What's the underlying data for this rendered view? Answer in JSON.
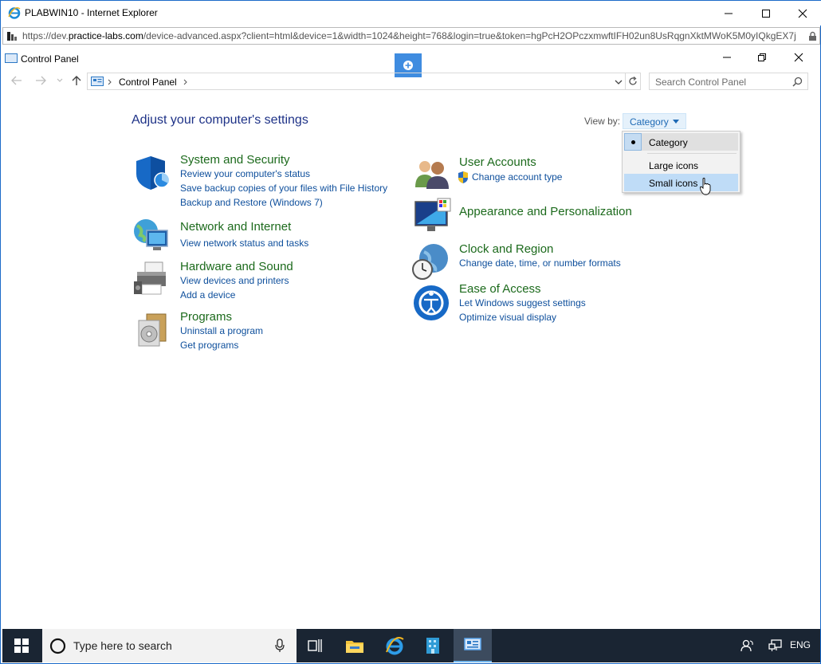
{
  "browser": {
    "title": "PLABWIN10 - Internet Explorer",
    "url_prefix": "https://dev.",
    "url_domain": "practice-labs.com",
    "url_rest": "/device-advanced.aspx?client=html&device=1&width=1024&height=768&login=true&token=hgPcH2OPczxmwftIFH02un8UsRqgnXktMWoK5M0yIQkgEX7j"
  },
  "window": {
    "title": "Control Panel"
  },
  "breadcrumb": {
    "location": "Control Panel"
  },
  "search": {
    "placeholder": "Search Control Panel"
  },
  "main": {
    "heading": "Adjust your computer's settings",
    "view_by_label": "View by:",
    "view_by_value": "Category"
  },
  "view_menu": {
    "options": [
      "Category",
      "Large icons",
      "Small icons"
    ],
    "selected": "Category",
    "hovered": "Small icons"
  },
  "categories_left": [
    {
      "title": "System and Security",
      "links": [
        "Review your computer's status",
        "Save backup copies of your files with File History",
        "Backup and Restore (Windows 7)"
      ]
    },
    {
      "title": "Network and Internet",
      "links": [
        "View network status and tasks"
      ]
    },
    {
      "title": "Hardware and Sound",
      "links": [
        "View devices and printers",
        "Add a device"
      ]
    },
    {
      "title": "Programs",
      "links": [
        "Uninstall a program",
        "Get programs"
      ]
    }
  ],
  "categories_right": [
    {
      "title": "User Accounts",
      "links": [
        "Change account type"
      ]
    },
    {
      "title": "Appearance and Personalization",
      "links": []
    },
    {
      "title": "Clock and Region",
      "links": [
        "Change date, time, or number formats"
      ]
    },
    {
      "title": "Ease of Access",
      "links": [
        "Let Windows suggest settings",
        "Optimize visual display"
      ]
    }
  ],
  "taskbar": {
    "search_placeholder": "Type here to search",
    "language": "ENG"
  },
  "colors": {
    "link": "#0e4f9c",
    "category_title": "#1c6a1c",
    "heading": "#1e3287",
    "taskbar": "#1a2533",
    "accent": "#3f8ce0"
  }
}
